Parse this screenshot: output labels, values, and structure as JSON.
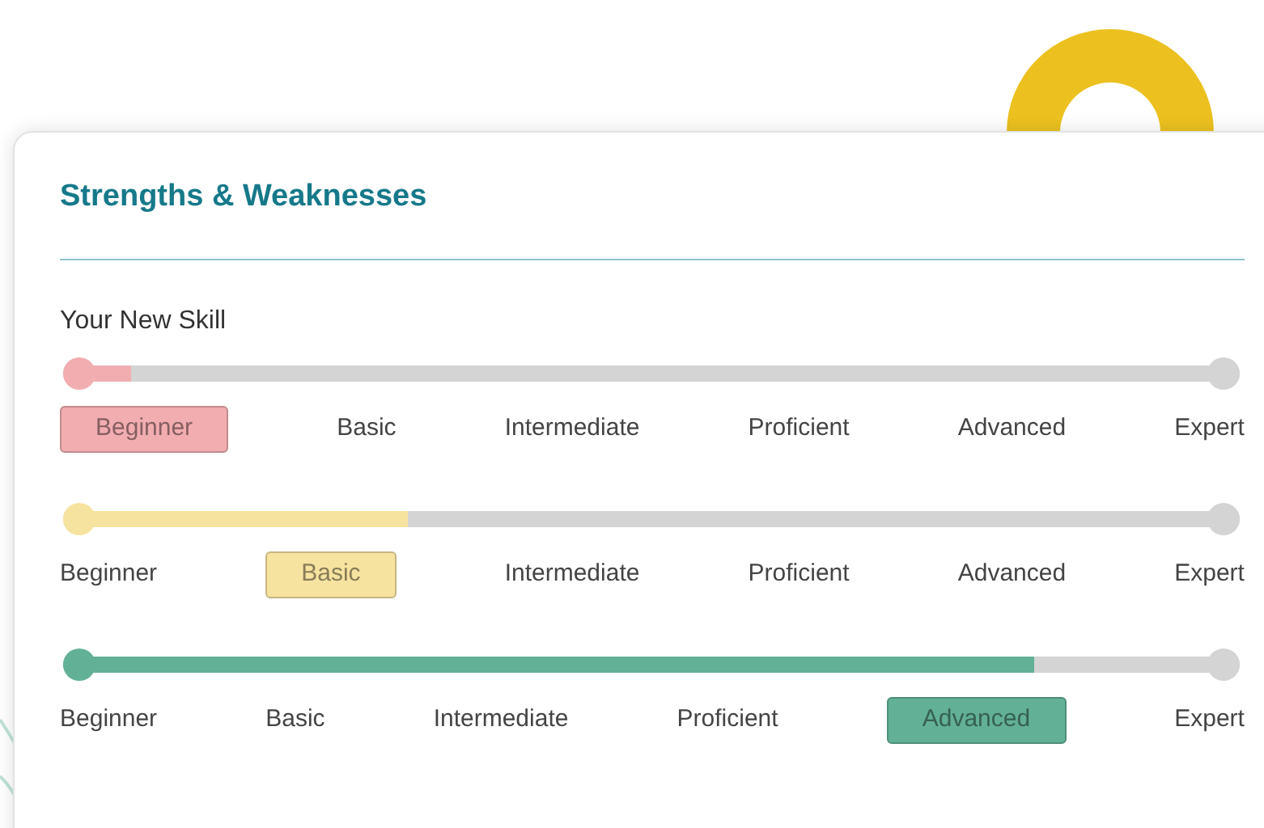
{
  "card": {
    "title": "Strengths & Weaknesses"
  },
  "skills": [
    {
      "label": "Your New Skill",
      "color": "#f2adb0",
      "level": 0.058,
      "levels": [
        {
          "label": "Beginner",
          "selected": true
        },
        {
          "label": "Basic",
          "selected": false
        },
        {
          "label": "Intermediate",
          "selected": false
        },
        {
          "label": "Proficient",
          "selected": false
        },
        {
          "label": "Advanced",
          "selected": false
        },
        {
          "label": "Expert",
          "selected": false
        }
      ]
    },
    {
      "color": "#f7e3a0",
      "level": 0.293,
      "levels": [
        {
          "label": "Beginner",
          "selected": false
        },
        {
          "label": "Basic",
          "selected": true
        },
        {
          "label": "Intermediate",
          "selected": false
        },
        {
          "label": "Proficient",
          "selected": false
        },
        {
          "label": "Advanced",
          "selected": false
        },
        {
          "label": "Expert",
          "selected": false
        }
      ]
    },
    {
      "color": "#62b196",
      "level": 0.825,
      "levels": [
        {
          "label": "Beginner",
          "selected": false
        },
        {
          "label": "Basic",
          "selected": false
        },
        {
          "label": "Intermediate",
          "selected": false
        },
        {
          "label": "Proficient",
          "selected": false
        },
        {
          "label": "Advanced",
          "selected": true
        },
        {
          "label": "Expert",
          "selected": false
        }
      ]
    }
  ]
}
